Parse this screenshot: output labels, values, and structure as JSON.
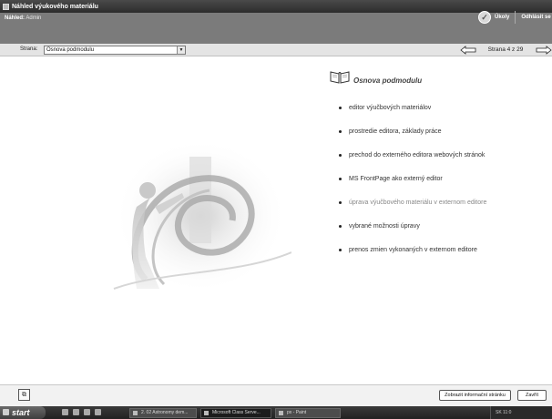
{
  "window": {
    "title": "Náhled výukového materiálu"
  },
  "header": {
    "user_label": "Náhled:",
    "user_value": "Admin",
    "tasks_label": "Úkoly",
    "logout_label": "Odhlásit se"
  },
  "nav": {
    "page_label": "Strana:",
    "page_select_value": "Osnova podmodulu",
    "page_count": "Strana  4 z 29",
    "current_page": 4,
    "total_pages": 29
  },
  "content": {
    "section_title": "Osnova podmodulu",
    "items": [
      {
        "label": "editor výučbových materiálov",
        "dim": false
      },
      {
        "label": "prostredie editora, základy práce",
        "dim": false
      },
      {
        "label": "prechod do externého editora webových stránok",
        "dim": false
      },
      {
        "label": "MS FrontPage ako externý editor",
        "dim": false
      },
      {
        "label": "úprava výučbového materiálu v externom editore",
        "dim": true
      },
      {
        "label": "vybrané možnosti úpravy",
        "dim": false
      },
      {
        "label": "prenos zmien vykonaných v externom editore",
        "dim": false
      }
    ]
  },
  "footer": {
    "info_button": "Zobrazit informační stránku",
    "close_button": "Zavřít"
  },
  "taskbar": {
    "start_label": "start",
    "tasks": [
      "2. 02 Astronomy dem...",
      "Microsoft Class Serve...",
      "px - Paint"
    ],
    "tray_text": "SK  11:0"
  },
  "colors": {
    "titlebar": "#333333",
    "header": "#7b7b7b",
    "navstrip": "#e4e4e4",
    "taskbar": "#2a2a2a"
  }
}
